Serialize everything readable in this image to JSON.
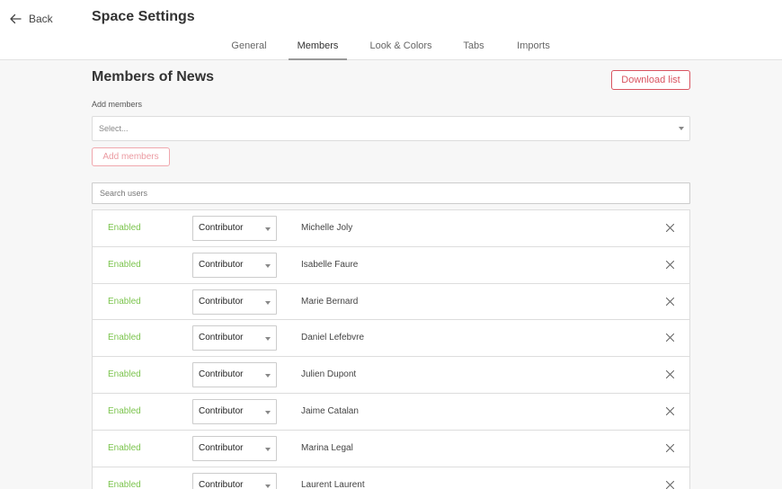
{
  "header": {
    "back_label": "Back",
    "title": "Space Settings"
  },
  "tabs": [
    {
      "label": "General",
      "active": false
    },
    {
      "label": "Members",
      "active": true
    },
    {
      "label": "Look & Colors",
      "active": false
    },
    {
      "label": "Tabs",
      "active": false
    },
    {
      "label": "Imports",
      "active": false
    }
  ],
  "main": {
    "title": "Members of News",
    "download_label": "Download list",
    "add_members_label": "Add members",
    "select_placeholder": "Select...",
    "add_button_label": "Add members",
    "search_placeholder": "Search users"
  },
  "members": [
    {
      "status": "Enabled",
      "role": "Contributor",
      "name": "Michelle Joly"
    },
    {
      "status": "Enabled",
      "role": "Contributor",
      "name": "Isabelle Faure"
    },
    {
      "status": "Enabled",
      "role": "Contributor",
      "name": "Marie Bernard"
    },
    {
      "status": "Enabled",
      "role": "Contributor",
      "name": "Daniel Lefebvre"
    },
    {
      "status": "Enabled",
      "role": "Contributor",
      "name": "Julien Dupont"
    },
    {
      "status": "Enabled",
      "role": "Contributor",
      "name": "Jaime Catalan"
    },
    {
      "status": "Enabled",
      "role": "Contributor",
      "name": "Marina Legal"
    },
    {
      "status": "Enabled",
      "role": "Contributor",
      "name": "Laurent Laurent"
    }
  ],
  "colors": {
    "accent_red": "#d9535f",
    "enabled_green": "#7cc44e"
  }
}
